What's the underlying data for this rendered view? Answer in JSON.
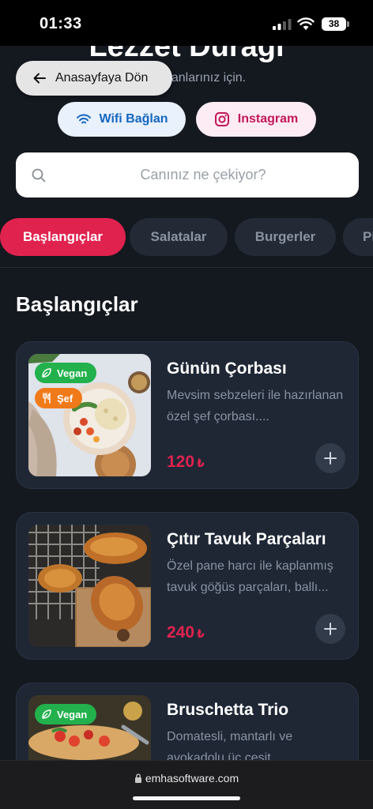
{
  "status_bar": {
    "time": "01:33",
    "battery": "38"
  },
  "header": {
    "title": "Lezzet Durağı",
    "subtitle": "i anlarınız için."
  },
  "back_button": {
    "label": "Anasayfaya Dön"
  },
  "links": {
    "wifi_label": "Wifi Bağlan",
    "instagram_label": "Instagram"
  },
  "search": {
    "placeholder": "Canınız ne çekiyor?"
  },
  "tabs": [
    {
      "label": "Başlangıçlar",
      "active": true
    },
    {
      "label": "Salatalar",
      "active": false
    },
    {
      "label": "Burgerler",
      "active": false
    },
    {
      "label": "Pi",
      "active": false
    }
  ],
  "section": {
    "title": "Başlangıçlar"
  },
  "menu_items": [
    {
      "name": "Günün Çorbası",
      "description": "Mevsim sebzeleri ile hazırlanan özel şef çorbası....",
      "price": "120",
      "currency": "₺",
      "badges": [
        "Vegan",
        "Şef"
      ]
    },
    {
      "name": "Çıtır Tavuk Parçaları",
      "description": "Özel pane harcı ile kaplanmış tavuk göğüs parçaları, ballı...",
      "price": "240",
      "currency": "₺",
      "badges": []
    },
    {
      "name": "Bruschetta Trio",
      "description": "Domatesli, mantarlı ve avokadolu üç çeşit...",
      "price": "",
      "currency": "",
      "badges": [
        "Vegan"
      ]
    }
  ],
  "browser": {
    "url": "emhasoftware.com"
  },
  "colors": {
    "accent": "#e0234e",
    "background": "#14181f",
    "card": "#1f2735",
    "vegan_badge": "#22b14c",
    "chef_badge": "#f07a1a"
  }
}
